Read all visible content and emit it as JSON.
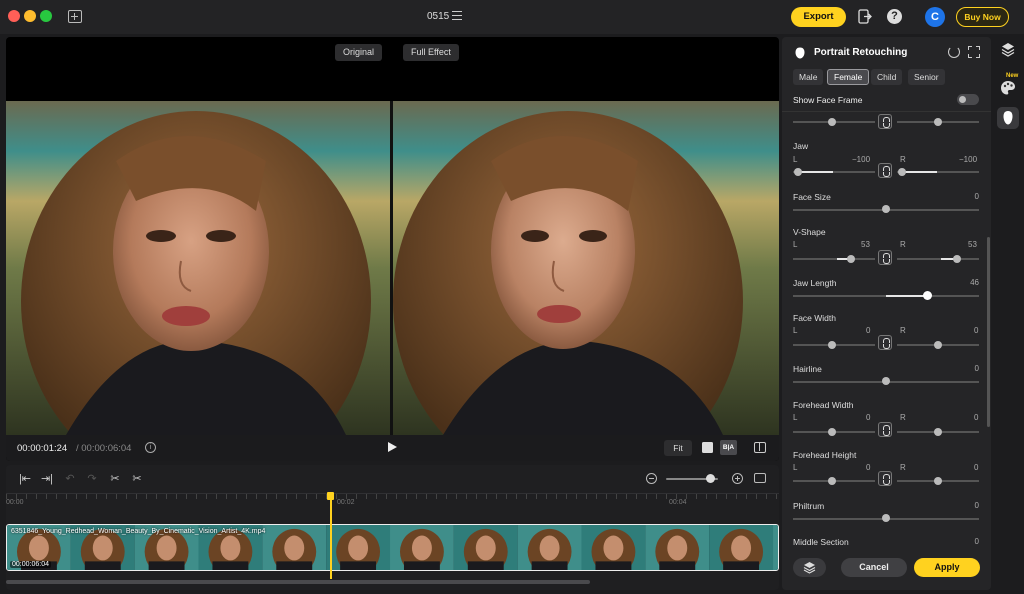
{
  "window": {
    "project_title": "0515",
    "export_label": "Export",
    "buy_label": "Buy Now",
    "avatar_letter": "C"
  },
  "preview": {
    "original_label": "Original",
    "full_effect_label": "Full Effect",
    "current_time": "00:00:01:24",
    "total_time": "/ 00:00:06:04",
    "fit_label": "Fit",
    "ba_label": "B|A"
  },
  "timeline": {
    "ruler_labels": [
      "00:00",
      "00:02",
      "00:04"
    ],
    "clip_name": "6351846_Young_Redhead_Woman_Beauty_By_Cinematic_Vision_Artist_4K.mp4",
    "clip_duration": "00:00:06:04"
  },
  "panel": {
    "title": "Portrait Retouching",
    "gender_options": [
      "Male",
      "Female",
      "Child",
      "Senior"
    ],
    "selected_gender": "Female",
    "show_face_frame_label": "Show Face Frame",
    "left_label": "L",
    "right_label": "R",
    "properties": {
      "jaw": {
        "title": "Jaw",
        "left": "−100",
        "right": "−100"
      },
      "face_size": {
        "title": "Face Size",
        "value": "0"
      },
      "v_shape": {
        "title": "V-Shape",
        "left": "53",
        "right": "53"
      },
      "jaw_length": {
        "title": "Jaw Length",
        "value": "46"
      },
      "face_width": {
        "title": "Face Width",
        "left": "0",
        "right": "0"
      },
      "hairline": {
        "title": "Hairline",
        "value": "0"
      },
      "forehead_width": {
        "title": "Forehead Width",
        "left": "0",
        "right": "0"
      },
      "forehead_height": {
        "title": "Forehead Height",
        "left": "0",
        "right": "0"
      },
      "philtrum": {
        "title": "Philtrum",
        "value": "0"
      },
      "middle_section": {
        "title": "Middle Section",
        "value": "0"
      }
    },
    "cancel_label": "Cancel",
    "apply_label": "Apply"
  },
  "side_toolbar": {
    "new_badge": "New"
  },
  "colors": {
    "accent": "#ffd21f",
    "avatar": "#1e74e8",
    "panel_bg": "#252527"
  },
  "icons": [
    "new-project-icon",
    "list-icon",
    "exit-icon",
    "help-icon",
    "info-icon",
    "play-icon",
    "split-view-icon",
    "cut-icon",
    "undo-icon",
    "redo-icon",
    "layers-icon",
    "palette-icon",
    "face-icon",
    "reset-icon",
    "face-frame-icon",
    "link-icon"
  ]
}
